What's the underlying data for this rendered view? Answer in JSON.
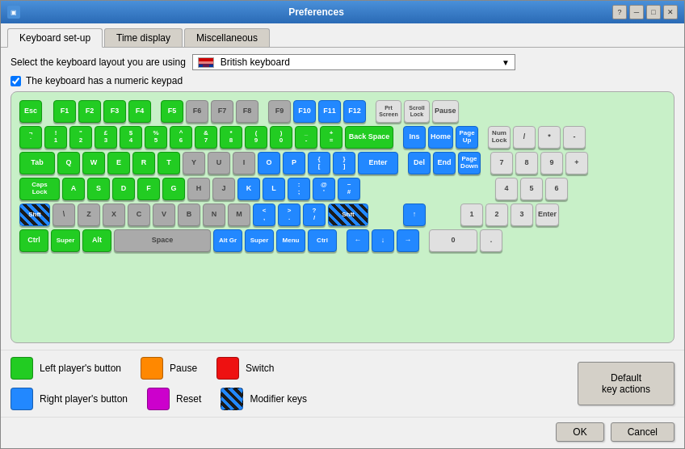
{
  "window": {
    "title": "Preferences"
  },
  "titlebar": {
    "help_label": "?",
    "minimize_label": "─",
    "maximize_label": "□",
    "close_label": "✕"
  },
  "tabs": [
    {
      "label": "Keyboard set-up",
      "active": true
    },
    {
      "label": "Time display",
      "active": false
    },
    {
      "label": "Miscellaneous",
      "active": false
    }
  ],
  "keyboard_select": {
    "label": "Select the keyboard layout you are using",
    "value": "British keyboard"
  },
  "checkbox": {
    "label": "The keyboard has a numeric keypad",
    "checked": true
  },
  "legend": {
    "items": [
      {
        "color": "green",
        "label": "Left player's button"
      },
      {
        "color": "orange",
        "label": "Pause"
      },
      {
        "color": "red",
        "label": "Switch"
      },
      {
        "color": "blue",
        "label": "Right player's button"
      },
      {
        "color": "magenta",
        "label": "Reset"
      },
      {
        "color": "striped",
        "label": "Modifier keys"
      }
    ]
  },
  "default_btn": {
    "label": "Default\nkey actions"
  },
  "bottom": {
    "ok_label": "OK",
    "cancel_label": "Cancel"
  }
}
